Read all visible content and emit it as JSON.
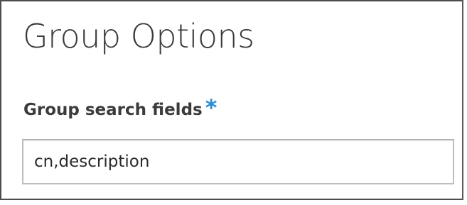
{
  "section": {
    "title": "Group Options"
  },
  "field": {
    "label": "Group search fields",
    "required_marker": "*",
    "value": "cn,description",
    "required_color": "#2a8dd4"
  }
}
